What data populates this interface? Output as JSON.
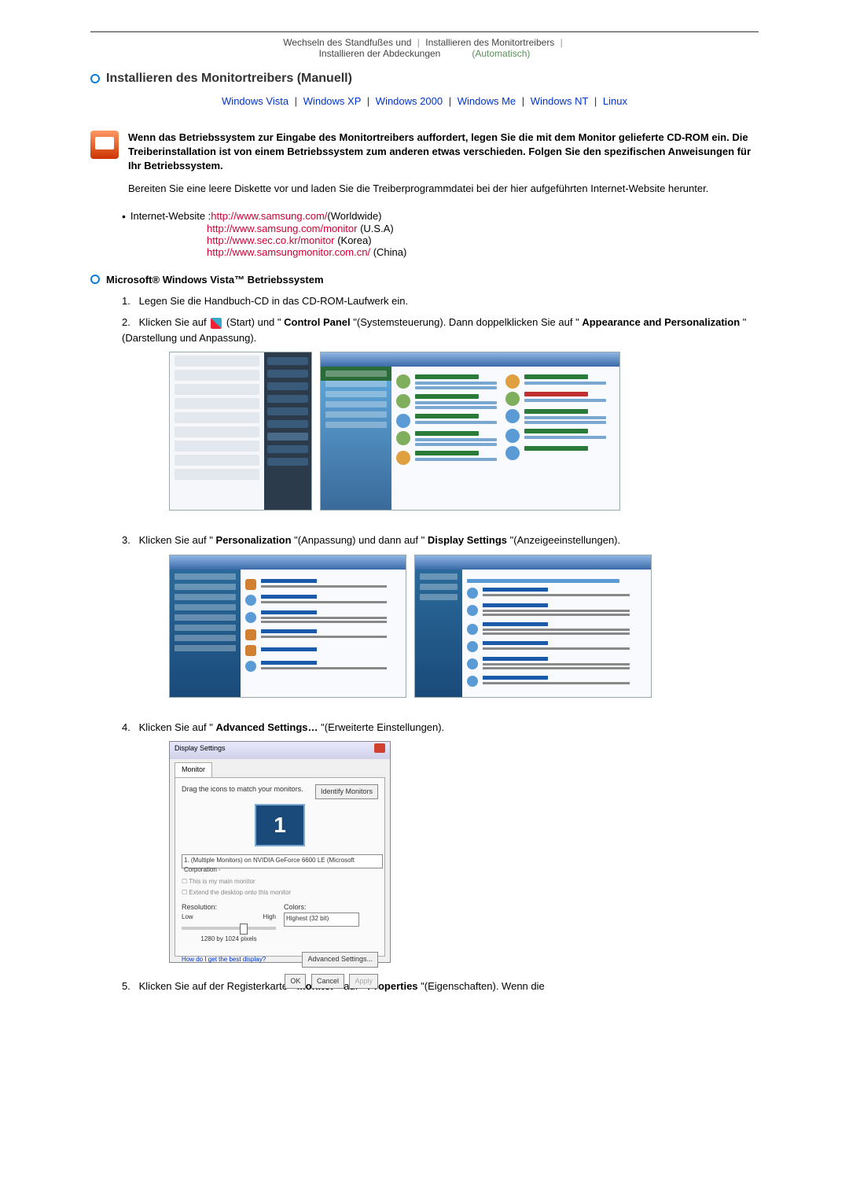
{
  "top_links": {
    "left1": "Wechseln des Standfußes und",
    "left2": "Installieren der Abdeckungen",
    "right1": "Installieren des Monitortreibers",
    "right2": "(Automatisch)"
  },
  "section_title": "Installieren des Monitortreibers (Manuell)",
  "os_links": {
    "vista": "Windows Vista",
    "xp": "Windows XP",
    "w2000": "Windows 2000",
    "me": "Windows Me",
    "nt": "Windows NT",
    "linux": "Linux"
  },
  "intro": {
    "bold": "Wenn das Betriebssystem zur Eingabe des Monitortreibers auffordert, legen Sie die mit dem Monitor gelieferte CD-ROM ein. Die Treiberinstallation ist von einem Betriebssystem zum anderen etwas verschieden. Folgen Sie den spezifischen Anweisungen für Ihr Betriebssystem.",
    "plain": "Bereiten Sie eine leere Diskette vor und laden Sie die Treiberprogrammdatei bei der hier aufgeführten Internet-Website herunter."
  },
  "websites": {
    "label": "Internet-Website :",
    "rows": [
      {
        "url": "http://www.samsung.com/",
        "suffix": " (Worldwide)"
      },
      {
        "url": "http://www.samsung.com/monitor",
        "suffix": " (U.S.A)"
      },
      {
        "url": "http://www.sec.co.kr/monitor",
        "suffix": " (Korea)"
      },
      {
        "url": "http://www.samsungmonitor.com.cn/",
        "suffix": " (China)"
      }
    ]
  },
  "subsection_title": "Microsoft® Windows Vista™ Betriebssystem",
  "steps": {
    "s1": "Legen Sie die Handbuch-CD in das CD-ROM-Laufwerk ein.",
    "s2_a": "Klicken Sie auf ",
    "s2_b": "(Start) und \"",
    "s2_c": "Control Panel",
    "s2_d": "\"(Systemsteuerung). Dann doppelklicken Sie auf \"",
    "s2_e": "Appearance and Personalization",
    "s2_f": "\"(Darstellung und Anpassung).",
    "s3_a": "Klicken Sie auf \"",
    "s3_b": "Personalization",
    "s3_c": "\"(Anpassung) und dann auf \"",
    "s3_d": "Display Settings",
    "s3_e": "\"(Anzeigeeinstellungen).",
    "s4_a": "Klicken Sie auf \"",
    "s4_b": "Advanced Settings…",
    "s4_c": "\"(Erweiterte Einstellungen).",
    "s5_a": "Klicken Sie auf der Registerkarte \"",
    "s5_b": "Monitor",
    "s5_c": "\" auf \"",
    "s5_d": "Properties",
    "s5_e": "\"(Eigenschaften). Wenn die"
  },
  "display_dialog": {
    "title": "Display Settings",
    "tab": "Monitor",
    "drag_text": "Drag the icons to match your monitors.",
    "identify": "Identify Monitors",
    "monitor_num": "1",
    "select": "1. (Multiple Monitors) on NVIDIA GeForce 6600 LE (Microsoft Corporation -",
    "check1": "This is my main monitor",
    "check2": "Extend the desktop onto this monitor",
    "resolution_label": "Resolution:",
    "low": "Low",
    "high": "High",
    "resolution_value": "1280 by 1024 pixels",
    "colors_label": "Colors:",
    "colors_value": "Highest (32 bit)",
    "help_link": "How do I get the best display?",
    "adv_btn": "Advanced Settings...",
    "ok": "OK",
    "cancel": "Cancel",
    "apply": "Apply"
  }
}
